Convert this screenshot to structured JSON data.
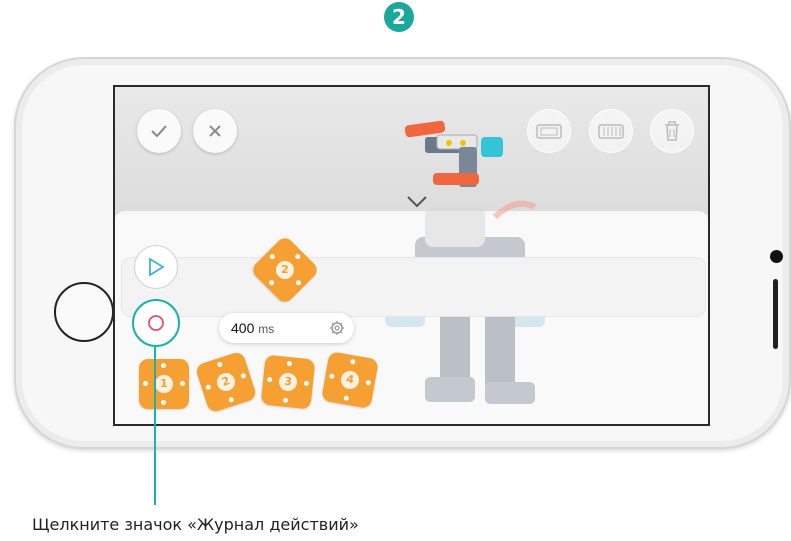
{
  "step": {
    "number": "2"
  },
  "screen": {
    "toolbar": {
      "confirm": {
        "icon": "check-icon"
      },
      "cancel": {
        "icon": "close-icon"
      },
      "right_buttons": [
        {
          "icon": "block-icon"
        },
        {
          "icon": "grid-icon"
        },
        {
          "icon": "trash-icon"
        }
      ]
    },
    "controls": {
      "play": {
        "icon": "play-icon"
      },
      "record": {
        "icon": "record-icon"
      }
    },
    "selected_action": {
      "label": "2"
    },
    "duration": {
      "value": "400",
      "unit": "ms"
    },
    "action_cards": [
      {
        "label": "1"
      },
      {
        "label": "2"
      },
      {
        "label": "3"
      },
      {
        "label": "4"
      }
    ]
  },
  "caption": "Щелкните значок «Журнал действий»",
  "colors": {
    "accent": "#19b3ac",
    "card": "#f6a033",
    "step_badge": "#1aa89c"
  }
}
